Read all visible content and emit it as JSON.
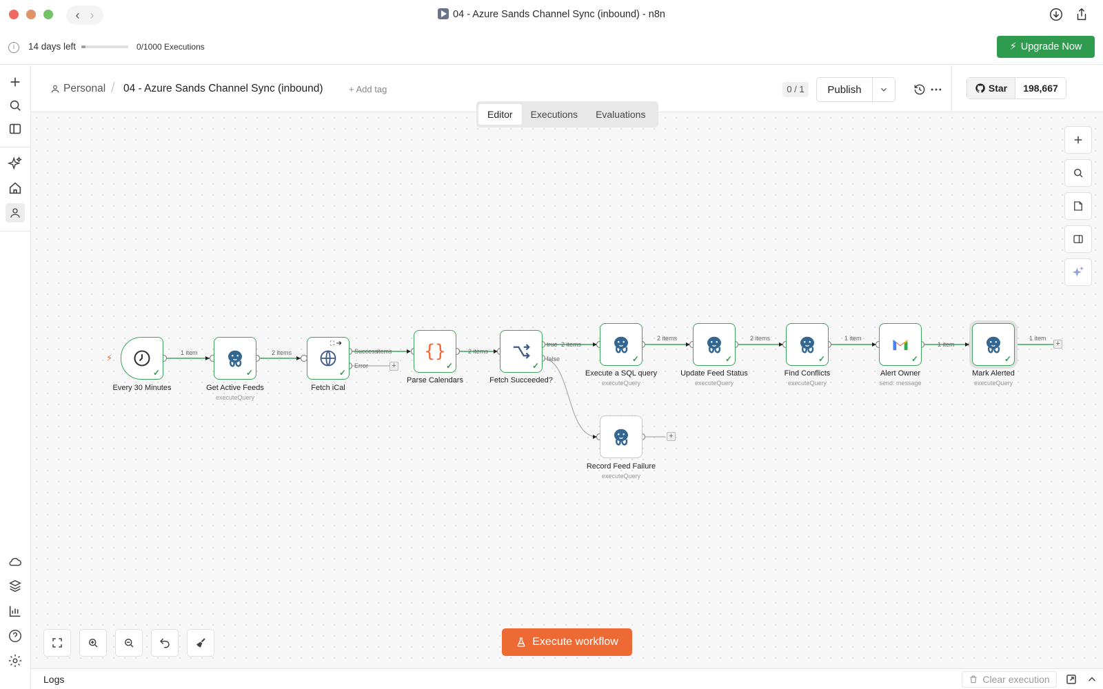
{
  "window": {
    "title": "04 - Azure Sands Channel Sync (inbound) - n8n"
  },
  "trial": {
    "days_left": "14 days left",
    "executions": "0/1000 Executions",
    "usage_fraction": 0.0,
    "upgrade_label": "Upgrade Now"
  },
  "header": {
    "project": "Personal",
    "workflow_name": "04 - Azure Sands Channel Sync (inbound)",
    "add_tag": "+ Add tag",
    "version": "0 / 1",
    "publish_label": "Publish",
    "star_label": "Star",
    "star_count": "198,667"
  },
  "tabs": [
    "Editor",
    "Executions",
    "Evaluations"
  ],
  "active_tab": "Editor",
  "nodes": [
    {
      "id": "every-30-minutes",
      "label": "Every 30 Minutes",
      "sub": "",
      "icon": "clock-icon"
    },
    {
      "id": "get-active-feeds",
      "label": "Get Active Feeds",
      "sub": "executeQuery",
      "icon": "postgres-icon"
    },
    {
      "id": "fetch-ical",
      "label": "Fetch iCal",
      "sub": "",
      "icon": "globe-icon"
    },
    {
      "id": "parse-calendars",
      "label": "Parse Calendars",
      "sub": "",
      "icon": "code-braces-icon"
    },
    {
      "id": "fetch-succeeded",
      "label": "Fetch Succeeded?",
      "sub": "",
      "icon": "if-branch-icon"
    },
    {
      "id": "execute-sql-query",
      "label": "Execute a SQL query",
      "sub": "executeQuery",
      "icon": "postgres-icon"
    },
    {
      "id": "update-feed-status",
      "label": "Update Feed Status",
      "sub": "executeQuery",
      "icon": "postgres-icon"
    },
    {
      "id": "find-conflicts",
      "label": "Find Conflicts",
      "sub": "executeQuery",
      "icon": "postgres-icon"
    },
    {
      "id": "alert-owner",
      "label": "Alert Owner",
      "sub": "send: message",
      "icon": "gmail-icon"
    },
    {
      "id": "mark-alerted",
      "label": "Mark Alerted",
      "sub": "executeQuery",
      "icon": "postgres-icon"
    },
    {
      "id": "record-feed-failure",
      "label": "Record Feed Failure",
      "sub": "executeQuery",
      "icon": "postgres-icon"
    }
  ],
  "edge_labels": {
    "e1": "1 item",
    "e2": "2 items",
    "success": "Success",
    "success_items": "items",
    "error": "Error",
    "e3": "2 items",
    "true_label": "true",
    "true_items": "2 items",
    "false_label": "false",
    "e5": "2 items",
    "e6": "2 items",
    "e7": "1 item",
    "e8": "1 item",
    "e9": "1 item"
  },
  "execute_label": "Execute workflow",
  "logs": {
    "label": "Logs",
    "clear_label": "Clear execution"
  },
  "colors": {
    "accent_orange": "#ee6a35",
    "success_green": "#2e9b4f",
    "postgres_blue": "#336791"
  }
}
